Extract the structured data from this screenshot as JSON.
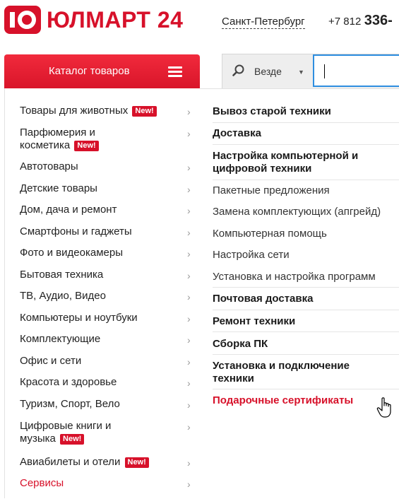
{
  "header": {
    "logo_text": "ЮЛМАРТ 24",
    "city": "Санкт-Петербург",
    "phone_code": "+7 812",
    "phone_main": "336-"
  },
  "catalog": {
    "label": "Каталог товаров"
  },
  "search": {
    "scope": "Везде",
    "placeholder": ""
  },
  "categories": [
    {
      "label": "Товары для животных",
      "new": "New!"
    },
    {
      "label": "Парфюмерия и",
      "label2": "косметика",
      "new": "New!"
    },
    {
      "label": "Автотовары"
    },
    {
      "label": "Детские товары"
    },
    {
      "label": "Дом, дача и ремонт"
    },
    {
      "label": "Смартфоны и гаджеты"
    },
    {
      "label": "Фото и видеокамеры"
    },
    {
      "label": "Бытовая техника"
    },
    {
      "label": "ТВ, Аудио, Видео"
    },
    {
      "label": "Компьютеры и ноутбуки"
    },
    {
      "label": "Комплектующие"
    },
    {
      "label": "Офис и сети"
    },
    {
      "label": "Красота и здоровье"
    },
    {
      "label": "Туризм, Спорт, Вело"
    },
    {
      "label": "Цифровые книги и",
      "label2": "музыка",
      "new": "New!"
    },
    {
      "label": "Авиабилеты и отели",
      "new": "New!"
    },
    {
      "label": "Сервисы"
    }
  ],
  "chevron": "›",
  "services": [
    {
      "label": "Вывоз старой техники"
    },
    {
      "label": "Доставка"
    },
    {
      "label": "Настройка компьютерной и",
      "label2": "цифровой техники"
    },
    {
      "label": "Пакетные предложения"
    },
    {
      "label": "Замена комплектующих (апгрейд)"
    },
    {
      "label": "Компьютерная помощь"
    },
    {
      "label": "Настройка сети"
    },
    {
      "label": "Установка и настройка программ"
    },
    {
      "label": "Почтовая доставка"
    },
    {
      "label": "Ремонт техники"
    },
    {
      "label": "Сборка ПК"
    },
    {
      "label": "Установка и подключение",
      "label2": "техники"
    },
    {
      "label": "Подарочные сертификаты"
    }
  ],
  "colors": {
    "brand": "#d7112a",
    "accent_blue": "#2e8ee0"
  }
}
